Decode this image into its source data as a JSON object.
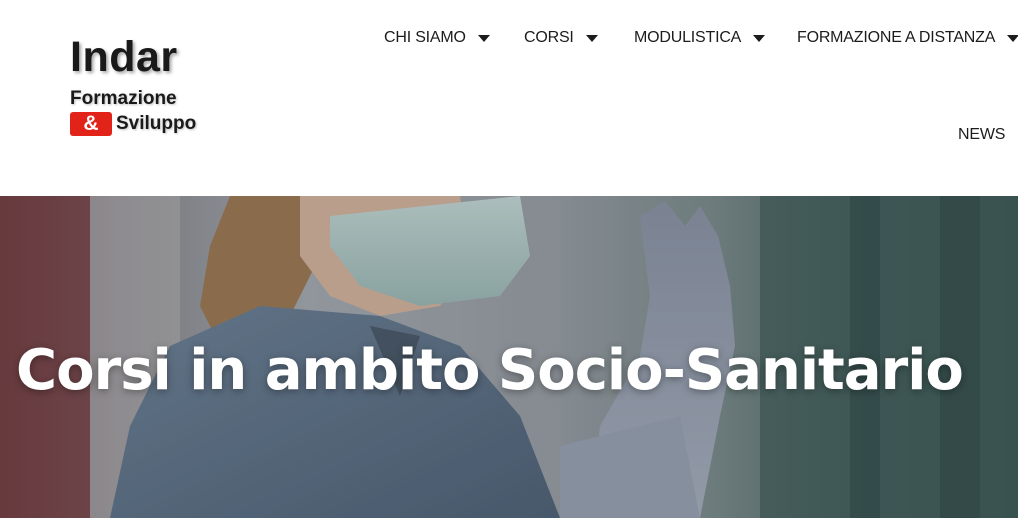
{
  "brand": {
    "name": "Indar",
    "line1": "Formazione",
    "amp": "&",
    "line2": "Sviluppo",
    "accent_color": "#e2231a"
  },
  "nav": {
    "items": [
      {
        "label": "CHI SIAMO",
        "has_dropdown": true,
        "icon": "caret-down-icon"
      },
      {
        "label": "CORSI",
        "has_dropdown": true,
        "icon": "caret-down-icon"
      },
      {
        "label": "MODULISTICA",
        "has_dropdown": true,
        "icon": "caret-down-icon"
      },
      {
        "label": "FORMAZIONE A DISTANZA",
        "has_dropdown": true,
        "icon": "caret-down-icon"
      },
      {
        "label": "NEWS",
        "has_dropdown": false
      }
    ]
  },
  "hero": {
    "title": "Corsi in ambito Socio-Sanitario",
    "image_description_icon": "nurse-with-gloves-photo"
  }
}
